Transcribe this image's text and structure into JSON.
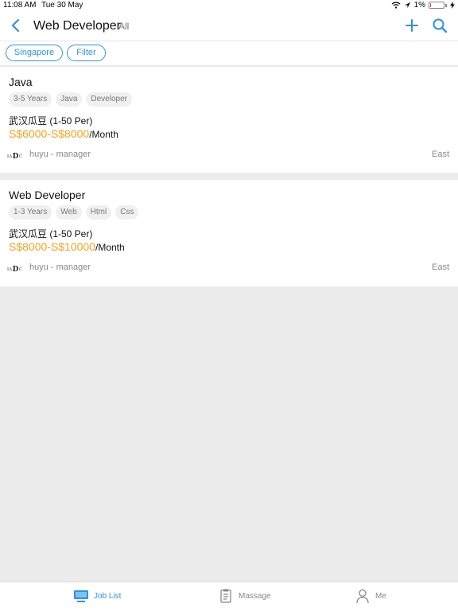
{
  "status_bar": {
    "time": "11:08 AM",
    "date": "Tue 30 May",
    "battery": "1%",
    "battery_level": 0.01
  },
  "nav": {
    "title": "Web Developer",
    "subtitle": "All",
    "icons": [
      "back-icon",
      "add-icon",
      "search-icon"
    ]
  },
  "filters": {
    "location": "Singapore",
    "filter": "Filter"
  },
  "jobs": [
    {
      "title": "Java",
      "tags": [
        "3-5 Years",
        "Java",
        "Developer"
      ],
      "company": "武汉瓜豆 (1-50 Per)",
      "salary": "S$6000-S$8000",
      "salary_unit": "/Month",
      "poster": "huyu - manager",
      "region": "East"
    },
    {
      "title": "Web Developer",
      "tags": [
        "1-3 Years",
        "Web",
        "Html",
        "Css"
      ],
      "company": "武汉瓜豆 (1-50 Per)",
      "salary": "S$8000-S$10000",
      "salary_unit": "/Month",
      "poster": "huyu - manager",
      "region": "East"
    }
  ],
  "tabs": [
    {
      "label": "Job List",
      "icon": "monitor-icon",
      "active": true
    },
    {
      "label": "Massage",
      "icon": "clipboard-icon",
      "active": false
    },
    {
      "label": "Me",
      "icon": "person-icon",
      "active": false
    }
  ],
  "colors": {
    "accent": "#2f93e0",
    "salary": "#f0a321",
    "background": "#ececec"
  }
}
